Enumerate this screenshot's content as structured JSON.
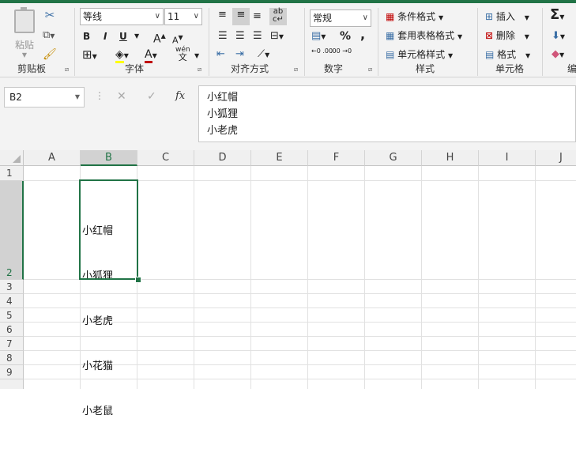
{
  "ribbon": {
    "clipboard": {
      "paste": "粘贴",
      "label": "剪贴板"
    },
    "font": {
      "name": "等线",
      "size": "11",
      "label": "字体",
      "bold": "B",
      "italic": "I",
      "underline": "U",
      "grow": "A",
      "shrink": "A",
      "color_letter": "A",
      "wen": "wén",
      "wen_char": "文"
    },
    "alignment": {
      "label": "对齐方式"
    },
    "number": {
      "format": "常规",
      "label": "数字",
      "percent": "%",
      "comma": ",",
      "inc": "←0 .00",
      "dec": ".00 →0"
    },
    "styles": {
      "conditional": "条件格式",
      "table": "套用表格格式",
      "cell": "单元格样式",
      "label": "样式"
    },
    "cells": {
      "insert": "插入",
      "delete": "删除",
      "format": "格式",
      "label": "单元格"
    },
    "editing": {
      "sum": "Σ",
      "label": "编"
    },
    "accent": "#217346"
  },
  "formula_bar": {
    "name_box": "B2",
    "cancel": "✕",
    "confirm": "✓",
    "fx": "fx",
    "content_lines": [
      "小红帽",
      "小狐狸",
      "小老虎"
    ]
  },
  "sheet": {
    "columns": [
      "A",
      "B",
      "C",
      "D",
      "E",
      "F",
      "G",
      "H",
      "I",
      "J"
    ],
    "rows": [
      "1",
      "2",
      "3",
      "4",
      "5",
      "6",
      "7",
      "8",
      "9"
    ],
    "selected_cell": "B2",
    "b2_lines": [
      "小红帽",
      "小狐狸",
      "小老虎",
      "小花猫",
      "小老鼠"
    ]
  }
}
